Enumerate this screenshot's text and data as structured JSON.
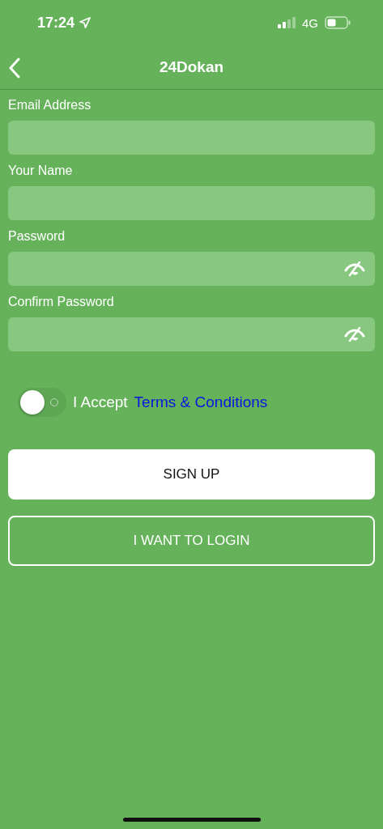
{
  "status_bar": {
    "time": "17:24",
    "network": "4G"
  },
  "header": {
    "title": "24Dokan"
  },
  "fields": [
    {
      "label": "Email Address",
      "kind": "text"
    },
    {
      "label": "Your Name",
      "kind": "text"
    },
    {
      "label": "Password",
      "kind": "password"
    },
    {
      "label": "Confirm Password",
      "kind": "password"
    }
  ],
  "terms": {
    "on": false,
    "text": "I Accept",
    "link": "Terms & Conditions"
  },
  "buttons": [
    {
      "label": "SIGN UP",
      "kind": "primary"
    },
    {
      "label": "I WANT TO LOGIN",
      "kind": "outline"
    }
  ]
}
